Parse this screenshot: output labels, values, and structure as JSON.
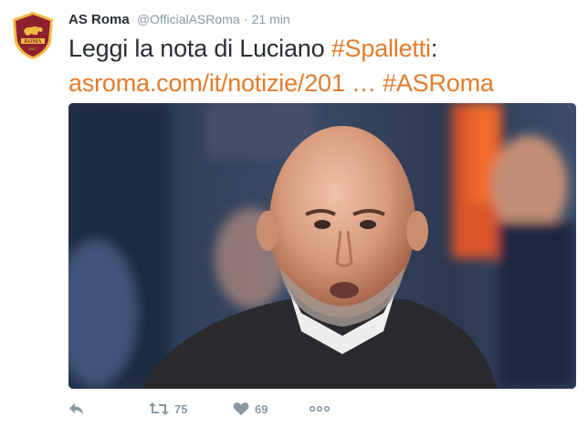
{
  "tweet": {
    "author_name": "AS Roma",
    "handle": "@OfficialASRoma",
    "separator": "·",
    "time": "21 min",
    "text_plain": "Leggi la nota di Luciano ",
    "hashtag_1": "#Spalletti",
    "colon": ":",
    "link": "asroma.com/it/notizie/201 …",
    "hashtag_2": "#ASRoma",
    "avatar_text": "ROMA",
    "avatar_year": "1927"
  },
  "actions": {
    "retweets": "75",
    "likes": "69"
  },
  "icons": {
    "reply": "reply-icon",
    "retweet": "retweet-icon",
    "like": "heart-icon",
    "more": "more-icon"
  },
  "colors": {
    "link": "#e37c2c",
    "name": "#292f33",
    "meta": "#8899a6",
    "crest_red": "#8e1f2f",
    "crest_gold": "#f0bc42"
  }
}
